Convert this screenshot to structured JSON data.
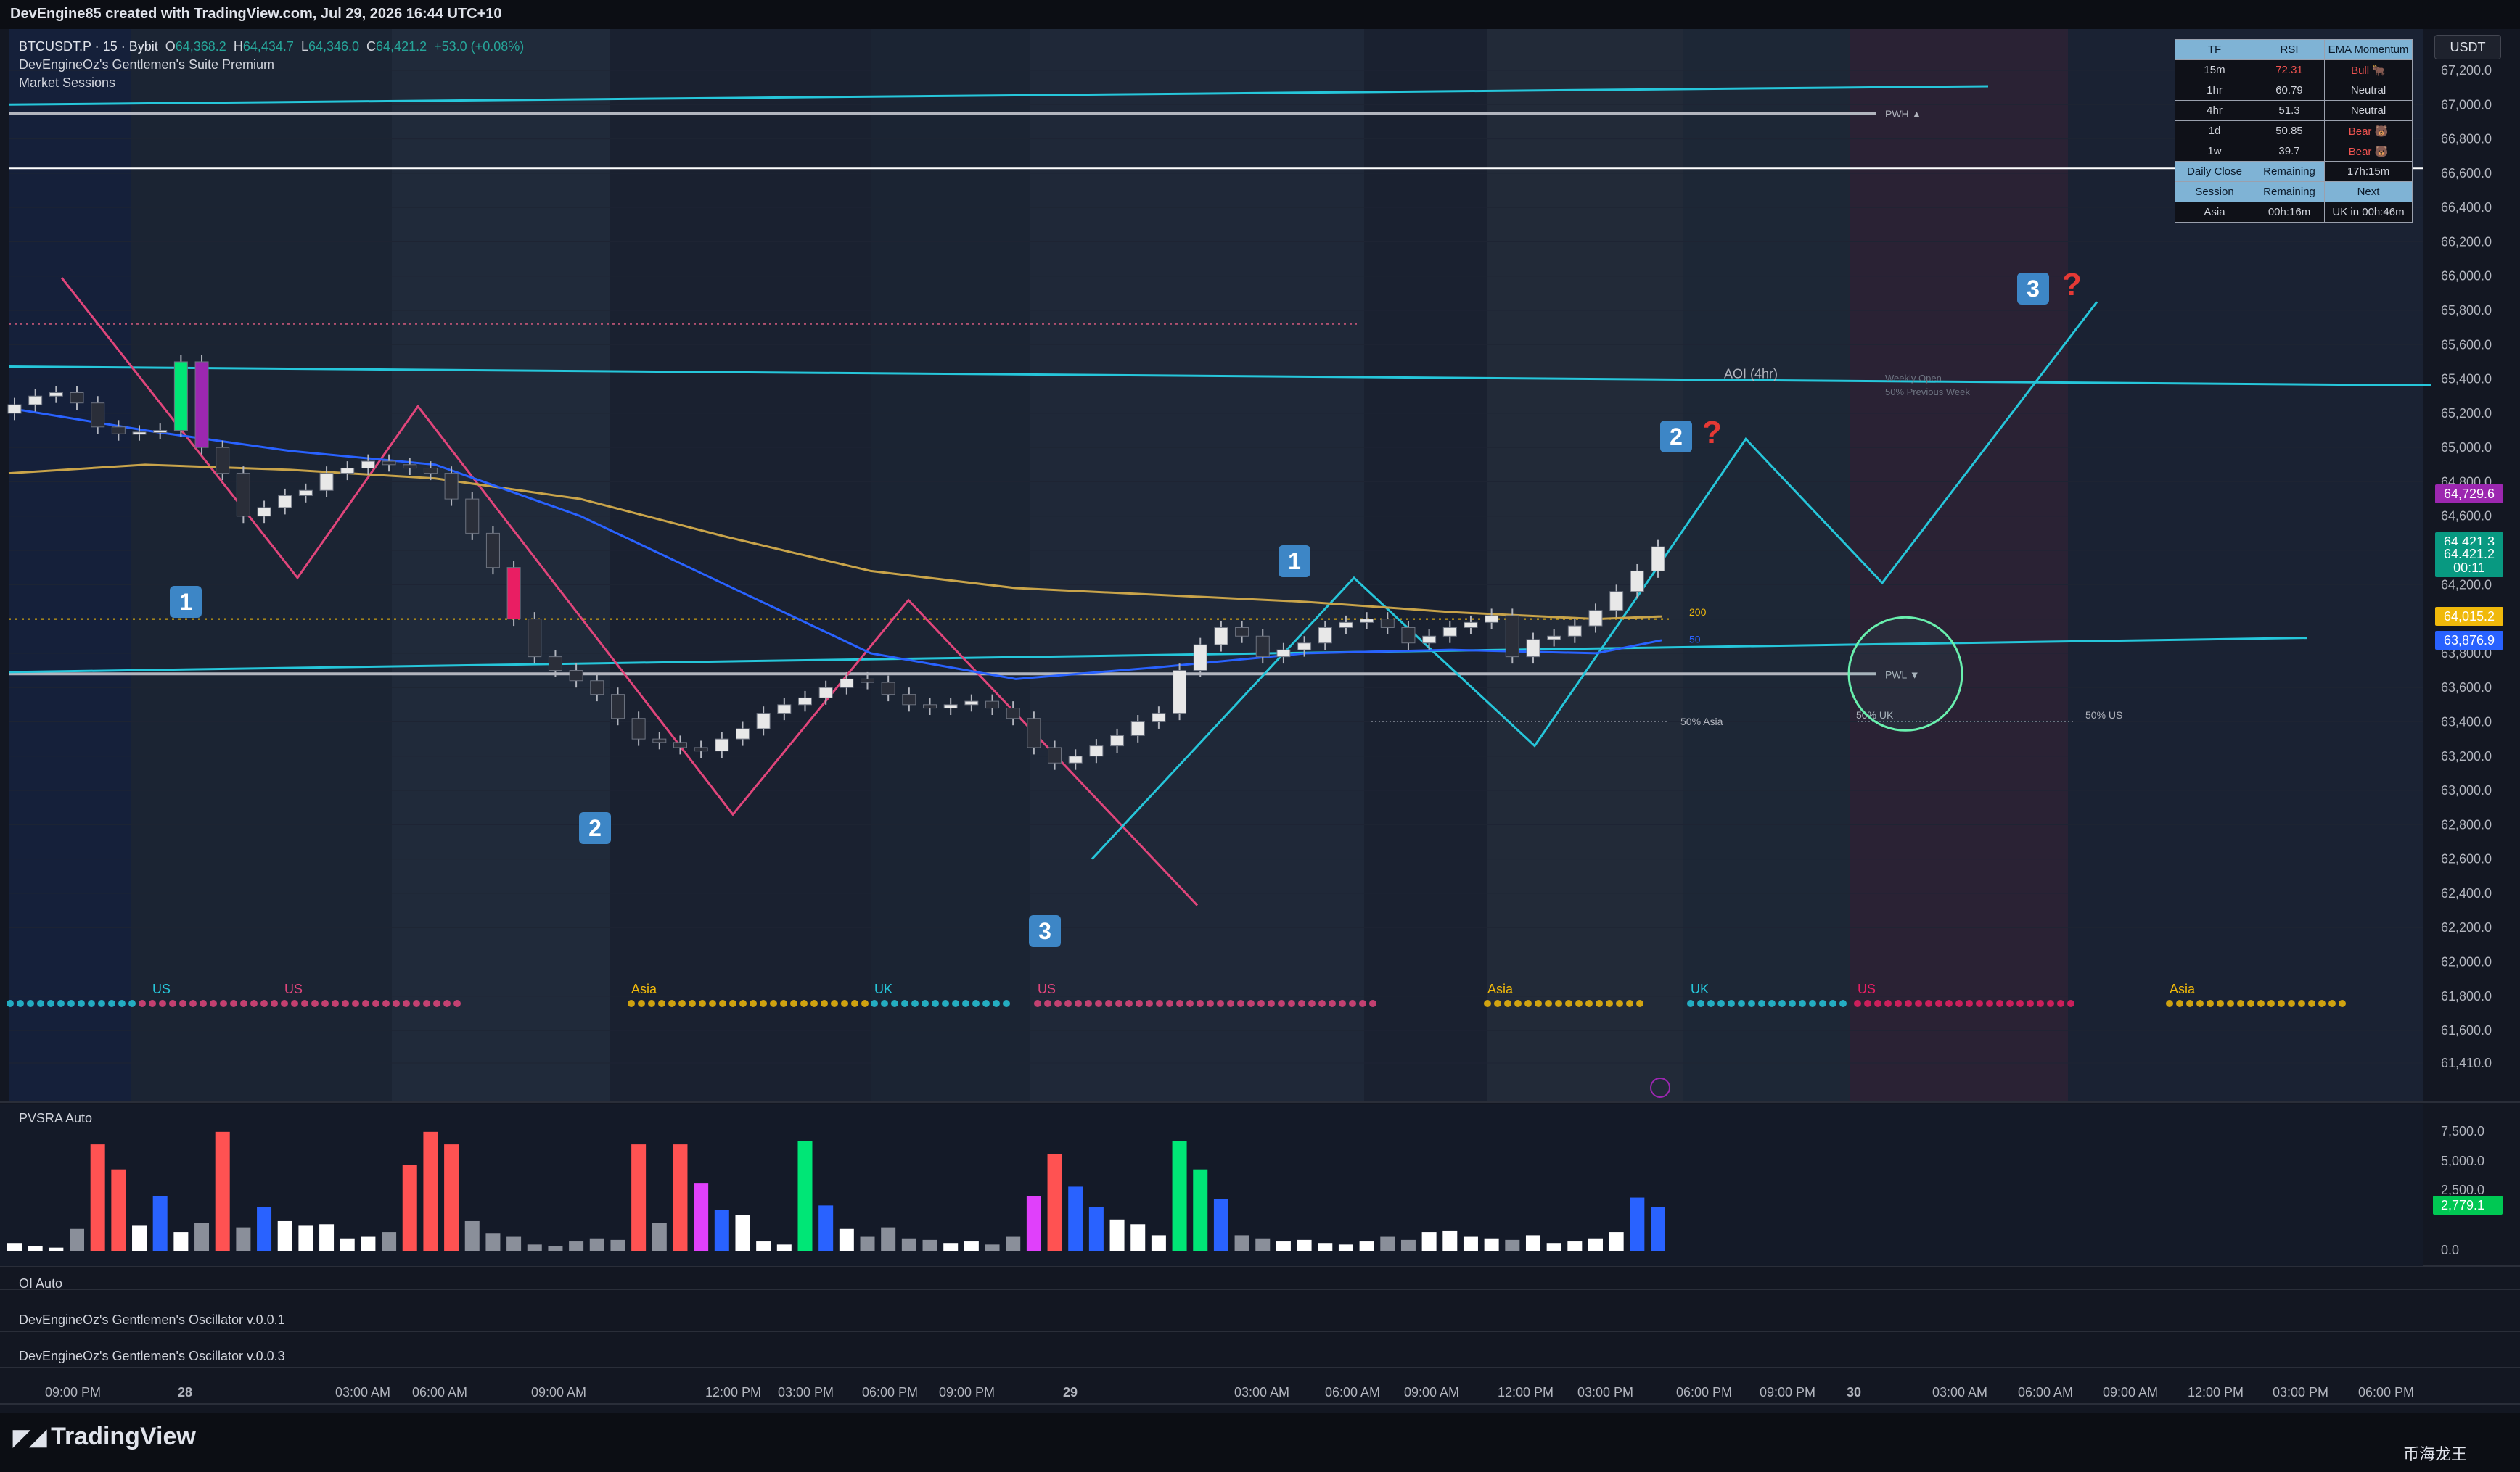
{
  "header": {
    "caption": "DevEngine85 created with TradingView.com, Jul 29, 2026 16:44 UTC+10"
  },
  "legend": {
    "symbol": "BTCUSDT.P · 15 · Bybit",
    "o_label": "O",
    "open": "64,368.2",
    "h_label": "H",
    "high": "64,434.7",
    "l_label": "L",
    "low": "64,346.0",
    "c_label": "C",
    "close": "64,421.2",
    "change": "+53.0 (+0.08%)",
    "indicators": [
      "DevEngineOz's Gentlemen's Suite Premium",
      "Market Sessions"
    ]
  },
  "unit_button": "USDT",
  "table": {
    "headers": [
      "TF",
      "RSI",
      "EMA Momentum"
    ],
    "rows": [
      {
        "tf": "15m",
        "rsi": "72.31",
        "ema": "Bull 🐂",
        "rsi_color": "#ef5350",
        "ema_color": "#ef5350"
      },
      {
        "tf": "1hr",
        "rsi": "60.79",
        "ema": "Neutral",
        "rsi_color": "#d1d4dc",
        "ema_color": "#d1d4dc"
      },
      {
        "tf": "4hr",
        "rsi": "51.3",
        "ema": "Neutral",
        "rsi_color": "#d1d4dc",
        "ema_color": "#d1d4dc"
      },
      {
        "tf": "1d",
        "rsi": "50.85",
        "ema": "Bear 🐻",
        "rsi_color": "#d1d4dc",
        "ema_color": "#ef5350"
      },
      {
        "tf": "1w",
        "rsi": "39.7",
        "ema": "Bear 🐻",
        "rsi_color": "#d1d4dc",
        "ema_color": "#ef5350"
      }
    ],
    "daily_close_label": "Daily Close",
    "remaining_label": "Remaining",
    "daily_remaining": "17h:15m",
    "session_label": "Session",
    "next_label": "Next",
    "session": "Asia",
    "session_remaining": "00h:16m",
    "next": "UK in 00h:46m"
  },
  "panes": {
    "pvsra": "PVSRA Auto",
    "oi": "OI Auto",
    "osc1": "DevEngineOz's Gentlemen's Oscillator v.0.0.1",
    "osc2": "DevEngineOz's Gentlemen's Oscillator v.0.0.3"
  },
  "volume_axis": [
    "7,500.0",
    "5,000.0",
    "2,500.0",
    "0.0"
  ],
  "volume_tag": "2,779.1",
  "footer": {
    "logo": "TradingView",
    "watermark": "币海龙王"
  },
  "price_tags": [
    {
      "label": "64,729.6",
      "price": 64729.6,
      "color": "#9c27b0"
    },
    {
      "label": "64,421.3",
      "price": 64450,
      "color": "#089981"
    },
    {
      "label": "64,421.2",
      "price": 64380,
      "color": "#089981"
    },
    {
      "label": "00:11",
      "price": 64300,
      "color": "#089981"
    },
    {
      "label": "64,015.2",
      "price": 64015.2,
      "color": "#f0b90b"
    },
    {
      "label": "63,876.9",
      "price": 63876.9,
      "color": "#2962ff"
    }
  ],
  "annotations": {
    "pwh": "PWH",
    "pwl": "PWL",
    "aoi": "AOI (4hr)",
    "weekly_open": "Weekly Open",
    "prev_week_50": "50% Previous Week",
    "ma200": "200",
    "ma50": "50",
    "asia50": "50% Asia",
    "uk50": "50% UK",
    "us50": "50% US",
    "badges": [
      "1",
      "2",
      "3",
      "1",
      "2",
      "3"
    ],
    "qmark": "?"
  },
  "session_labels": [
    "US",
    "Asia",
    "UK",
    "US",
    "Asia",
    "UK",
    "US",
    "Asia"
  ],
  "chart_data": {
    "type": "candlestick",
    "symbol": "BTCUSDT.P",
    "timeframe": "15",
    "ylim": [
      61410,
      67200
    ],
    "y_ticks": [
      67200,
      67000,
      66800,
      66600,
      66400,
      66200,
      66000,
      65800,
      65600,
      65400,
      65200,
      65000,
      64800,
      64600,
      64400,
      64200,
      64000,
      63800,
      63600,
      63400,
      63200,
      63000,
      62800,
      62600,
      62400,
      62200,
      62000,
      61800,
      61600,
      61410
    ],
    "x_ticks": [
      "09:00 PM",
      "28",
      "03:00 AM",
      "06:00 AM",
      "09:00 AM",
      "12:00 PM",
      "03:00 PM",
      "06:00 PM",
      "09:00 PM",
      "29",
      "03:00 AM",
      "06:00 AM",
      "09:00 AM",
      "12:00 PM",
      "03:00 PM",
      "06:00 PM",
      "09:00 PM",
      "30",
      "03:00 AM",
      "06:00 AM",
      "09:00 AM",
      "12:00 PM",
      "03:00 PM",
      "06:00 PM"
    ],
    "close_series": [
      65250,
      65300,
      65320,
      65260,
      65120,
      65080,
      65090,
      65100,
      65500,
      65000,
      64850,
      64600,
      64650,
      64720,
      64750,
      64850,
      64880,
      64920,
      64900,
      64880,
      64850,
      64700,
      64500,
      64300,
      64000,
      63780,
      63700,
      63640,
      63560,
      63420,
      63300,
      63280,
      63250,
      63230,
      63300,
      63360,
      63450,
      63500,
      63540,
      63600,
      63650,
      63630,
      63560,
      63500,
      63480,
      63500,
      63520,
      63480,
      63420,
      63250,
      63160,
      63200,
      63260,
      63320,
      63400,
      63450,
      63700,
      63850,
      63950,
      63900,
      63780,
      63820,
      63860,
      63950,
      63980,
      64000,
      63950,
      63860,
      63900,
      63950,
      63980,
      64020,
      63780,
      63880,
      63900,
      63960,
      64050,
      64160,
      64280,
      64421
    ],
    "ohlc_last": {
      "open": 64368.2,
      "high": 64434.7,
      "low": 64346.0,
      "close": 64421.2
    },
    "levels": {
      "pwh": 66950,
      "white_line": 66630,
      "pwl": 63680,
      "dotted_yellow": 64000,
      "aoi": 65430,
      "weekly_open": 65410
    },
    "pvsra_volume": [
      500,
      300,
      200,
      1400,
      6800,
      5200,
      1600,
      3500,
      1200,
      1800,
      7600,
      1500,
      2800,
      1900,
      1600,
      1700,
      800,
      900,
      1200,
      5500,
      7600,
      6800,
      1900,
      1100,
      900,
      400,
      300,
      600,
      800,
      700,
      6800,
      1800,
      6800,
      4300,
      2600,
      2300,
      600,
      400,
      7000,
      2900,
      1400,
      900,
      1500,
      800,
      700,
      500,
      600,
      400,
      900,
      3500,
      6200,
      4100,
      2800,
      2000,
      1700,
      1000,
      7000,
      5200,
      3300,
      1000,
      800,
      600,
      700,
      500,
      400,
      600,
      900,
      700,
      1200,
      1300,
      900,
      800,
      700,
      1000,
      500,
      600,
      800,
      1200,
      3400,
      2779
    ]
  }
}
